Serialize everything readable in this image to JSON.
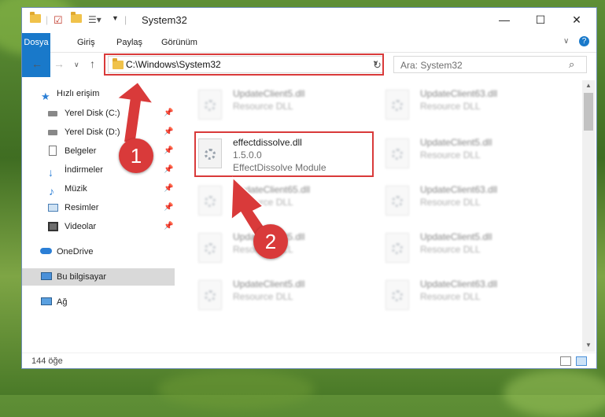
{
  "window": {
    "title": "System32",
    "controls": {
      "minimize": "—",
      "maximize": "☐",
      "close": "✕"
    }
  },
  "ribbon": {
    "tabs": [
      "Dosya",
      "Giriş",
      "Paylaş",
      "Görünüm"
    ]
  },
  "address": {
    "path": "C:\\Windows\\System32",
    "search_placeholder": "Ara: System32"
  },
  "sidebar": {
    "quick_access": "Hızlı erişim",
    "items": [
      {
        "label": "Yerel Disk (C:)",
        "icon": "drive-icon",
        "pinned": true
      },
      {
        "label": "Yerel Disk (D:)",
        "icon": "drive-icon",
        "pinned": true
      },
      {
        "label": "Belgeler",
        "icon": "documents-icon",
        "pinned": true
      },
      {
        "label": "İndirmeler",
        "icon": "downloads-icon",
        "pinned": true
      },
      {
        "label": "Müzik",
        "icon": "music-icon",
        "pinned": true
      },
      {
        "label": "Resimler",
        "icon": "pictures-icon",
        "pinned": true
      },
      {
        "label": "Videolar",
        "icon": "videos-icon",
        "pinned": true
      }
    ],
    "onedrive": "OneDrive",
    "this_pc": "Bu bilgisayar",
    "network": "Ağ"
  },
  "files": {
    "left": [
      {
        "name": "UpdateClient5.dll",
        "desc": "Resource DLL"
      },
      {
        "name": "UpdateClient65.dll",
        "desc": "Resource DLL"
      },
      {
        "name": "UpdateClient5.dll",
        "desc": "Resource DLL"
      },
      {
        "name": "UpdateClient5.dll",
        "desc": "Resource DLL"
      }
    ],
    "right": [
      {
        "name": "UpdateClient63.dll",
        "desc": "Resource DLL"
      },
      {
        "name": "UpdateClient5.dll",
        "desc": "Resource DLL"
      },
      {
        "name": "UpdateClient63.dll",
        "desc": "Resource DLL"
      },
      {
        "name": "UpdateClient5.dll",
        "desc": "Resource DLL"
      },
      {
        "name": "UpdateClient63.dll",
        "desc": "Resource DLL"
      }
    ],
    "highlighted": {
      "name": "effectdissolve.dll",
      "version": "1.5.0.0",
      "description": "EffectDissolve Module"
    }
  },
  "status": {
    "item_count": "144 öğe"
  },
  "annotations": {
    "step1": "1",
    "step2": "2",
    "accent": "#d93a3a"
  }
}
